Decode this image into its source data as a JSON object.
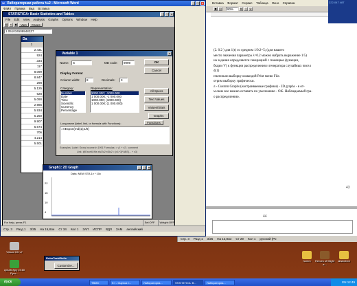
{
  "word_right": {
    "menu": [
      "Вставка",
      "Формат",
      "Сервис",
      "Таблица",
      "Окно",
      "Справка"
    ],
    "zoom": "90%",
    "lines": [
      "(2. 0.2 ) для 1(t) со средним 1/0.2=5; (для нашего",
      "место значения параметра λ=0.2 можно набрать выражение 1/5)",
      "на задания определяется генерацией с помощью функции,",
      "бкции V) к функции распределения и генератора случайных чисел",
      "d(1)",
      "нчательно выборку командой Print меню File.",
      "отрим выборку графически.",
      "л - Custom Graphs (настраиваемые графики) - 2D graphs - в от-",
      "м окне все можно оставить по умолчанию - OK. Наблюдаемый гра-",
      "о распределению."
    ],
    "ruler_page": "43",
    "page_number": "44",
    "status": {
      "page": "Стр. 3",
      "section": "Разд 1",
      "pages": "3/25",
      "pos": "На 12,8см",
      "line": "Ст 29",
      "col": "Кол 1",
      "lang": "русский (Ро"
    }
  },
  "word_left": {
    "title": "Лабораторная работа №2 - Microsoft Word",
    "menu": [
      "Файл",
      "Правка",
      "Вид",
      "Вставка"
    ],
    "status": {
      "page": "Стр. 3",
      "section": "Разд 1",
      "pages": "3/25",
      "pos": "На 15,8см",
      "line": "Ст 34",
      "col": "Кол 1",
      "extra": "ЗАП",
      "ispr": "ИСПР",
      "vdl": "ВДЛ",
      "zam": "ЗАМ",
      "lang": "английский"
    }
  },
  "statistica": {
    "title": "STATISTICA: Basic Statistics and Tables",
    "menu": [
      "File",
      "Edit",
      "View",
      "Analysis",
      "Graphs",
      "Options",
      "Window",
      "Help"
    ],
    "toolbar_labels": [
      "Vars",
      "Cases"
    ],
    "ref": "1.0510345099482Z7",
    "status_help": "For help, press F1",
    "status_sel": "Sel:OFF",
    "status_weight": "Weight:OFF"
  },
  "datasheet": {
    "title": "Da",
    "header": "1",
    "values": [
      "2.431",
      "924",
      ".334",
      "117",
      "8.099",
      "8.847",
      "298",
      "5.125",
      "628",
      "5.090",
      "2.986",
      "5.934",
      "5.250",
      "9.907",
      "5.674",
      "706",
      "4.214",
      "5.501"
    ]
  },
  "variable_dialog": {
    "title": "Variable 1",
    "name_label": "Name:",
    "name_value": "S",
    "md_label": "MD code:",
    "md_value": "9999",
    "ok": "OK",
    "cancel": "Cancel",
    "display_format": "Display Format",
    "col_width_label": "Column width:",
    "col_width_value": "8",
    "decimals_label": "Decimals:",
    "decimals_value": "3",
    "category_label": "Category:",
    "categories": [
      "Number",
      "Date",
      "Time",
      "Scientific",
      "Currency",
      "Percentage"
    ],
    "representation_label": "Representation:",
    "representations": [
      "1000.000; -1000.000",
      "1 000.000; -1 000.000",
      "1000.000; (1000.000)",
      "1 000.000; (1 000.000)"
    ],
    "all_specs": "All Specs",
    "text_values": "Text Values",
    "values_stats": "Values/Stats",
    "graphs": "Graphs",
    "long_name_label": "Long name (label, link, or formula with Functions):",
    "functions_btn": "Functions",
    "formula": "=VExpon(rnd(1);1/5)",
    "examples": "Examples:   Label:  Gross income in 1991      Formulas: = v1 + v2 ; comment",
    "examples2": "Link:  @Excel6:\\file.xls!2c2:r45c2       = (v1+3)*ABS(... + v3)"
  },
  "graph": {
    "title": "Graph1: 2D Graph",
    "chart_title": "Data: NEW STA 1v * 10c",
    "y_ticks": [
      "22",
      "16",
      "10",
      "4"
    ]
  },
  "customize": {
    "title": "RoboTask/Bulls",
    "button": "Customize..."
  },
  "desktop_icons": [
    {
      "label": "Virtual CD v7"
    },
    {
      "label": "cpAnti-Spy v3.60 Русс..."
    },
    {
      "label": "homm"
    },
    {
      "label": "Heroes of Might a..."
    },
    {
      "label": "aliskwhed"
    }
  ],
  "taskbar": {
    "start": "пуск",
    "tasks": [
      "TBMC",
      "K:\\ - Оценка т...",
      "Лабораторна...",
      "STATISTICA: B...",
      "Лабораторна..."
    ],
    "active_index": 3,
    "lang": "EN",
    "time": "12:49"
  },
  "mini_top_right": {
    "text": "222-047 487"
  }
}
